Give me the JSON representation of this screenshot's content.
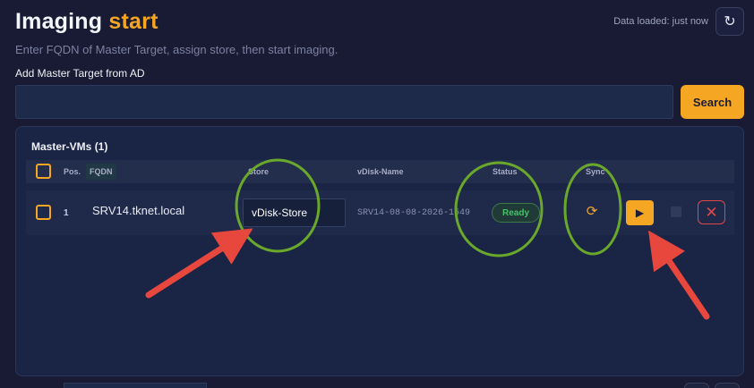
{
  "header": {
    "title_main": "Imaging",
    "title_accent": "start",
    "subtitle": "Enter FQDN of Master Target, assign store, then start imaging.",
    "data_loaded": "Data loaded: just now",
    "refresh_icon": "refresh-icon"
  },
  "search": {
    "label": "Add Master Target from AD",
    "value": "",
    "placeholder": "",
    "button_label": "Search"
  },
  "panel": {
    "title": "Master-VMs (1)",
    "columns": {
      "pos": "Pos.",
      "fqdn": "FQDN",
      "store": "Store",
      "vdisk": "vDisk-Name",
      "status": "Status",
      "sync": "Sync"
    },
    "rows": [
      {
        "pos": "1",
        "fqdn": "SRV14.tknet.local",
        "store": "vDisk-Store",
        "vdisk": "SRV14-08-08-2026-1549",
        "status": "Ready",
        "sync_icon": "sync-icon",
        "start_icon": "play-icon",
        "stop_icon": "stop-icon",
        "delete_icon": "close-icon"
      }
    ]
  },
  "colors": {
    "accent": "#f5a623",
    "background": "#181b33",
    "panel": "#1a2444",
    "status_ready": "#46c26a",
    "delete": "#e04848",
    "annotation_circle": "#6aa82c",
    "annotation_arrow": "#e8473d"
  }
}
